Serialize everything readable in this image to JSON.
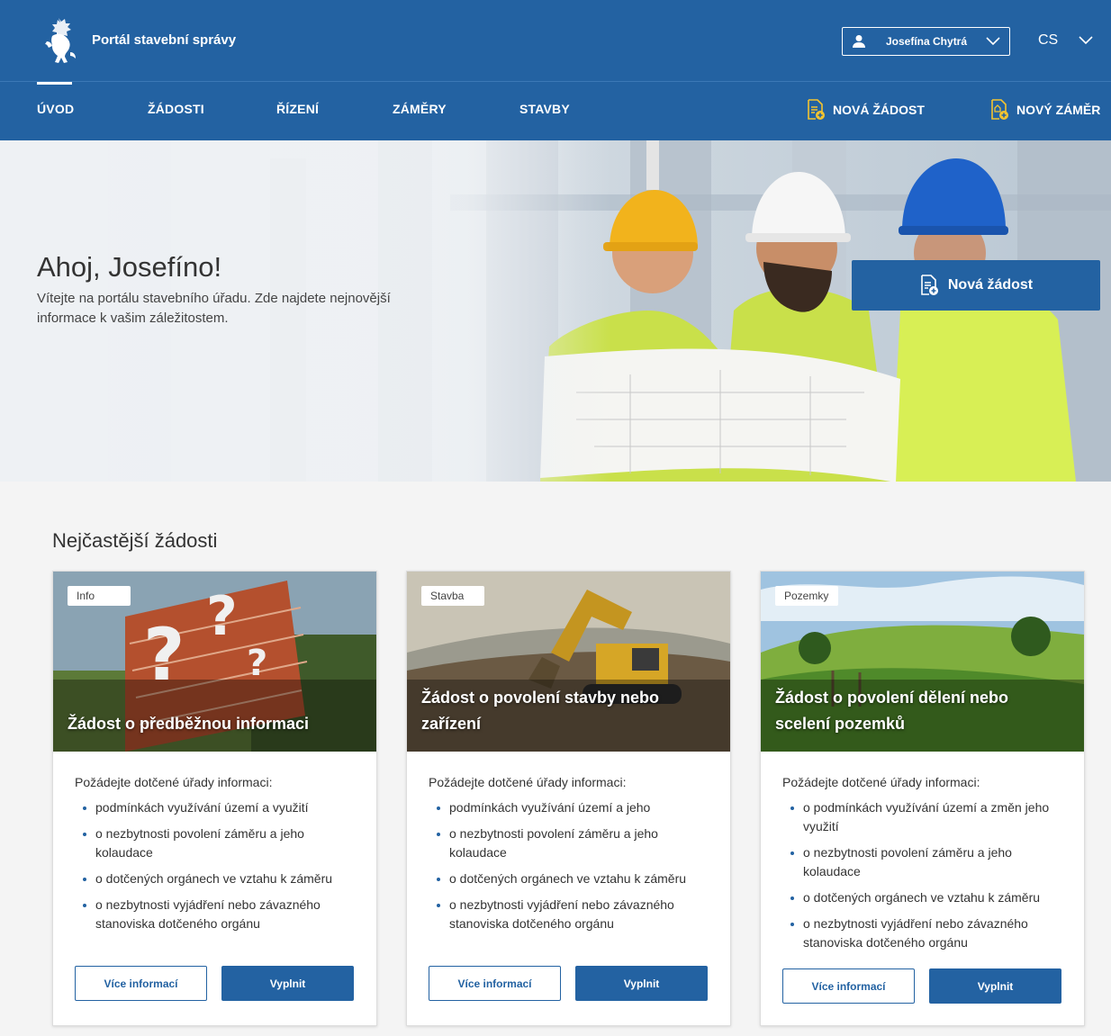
{
  "header": {
    "site_title": "Portál stavební správy",
    "user_name": "Josefína Chytrá",
    "language": "CS",
    "logo": "lion-emblem-icon"
  },
  "nav": {
    "items": [
      "ÚVOD",
      "ŽÁDOSTI",
      "ŘÍZENÍ",
      "ZÁMĚRY",
      "STAVBY"
    ],
    "active": "ÚVOD",
    "actions": [
      "NOVÁ ŽÁDOST",
      "NOVÝ ZÁMĚR"
    ]
  },
  "hero": {
    "title": "Ahoj, Josefíno!",
    "text": "Vítejte na portálu stavebního úřadu. Zde najdete nejnovější informace k vašim záležitostem.",
    "button": "Nová žádost"
  },
  "section": {
    "title": "Nejčastější žádosti"
  },
  "cards": [
    {
      "tag": "Info",
      "title": "Žádost o předběžnou informaci",
      "intro": "Požádejte dotčené úřady informaci:",
      "items": [
        "podmínkách využívání území a využití",
        "o nezbytnosti povolení záměru a jeho kolaudace",
        "o dotčených orgánech ve vztahu k záměru",
        "o nezbytnosti vyjádření nebo závazného stanoviska dotčeného orgánu"
      ],
      "more": "Více informací",
      "fill": "Vyplnit"
    },
    {
      "tag": "Stavba",
      "title": "Žádost o povolení stavby nebo zařízení",
      "intro": "Požádejte dotčené úřady informaci:",
      "items": [
        "podmínkách využívání území a jeho",
        "o nezbytnosti povolení záměru a jeho kolaudace",
        "o dotčených orgánech ve vztahu k záměru",
        "o nezbytnosti vyjádření nebo závazného stanoviska dotčeného orgánu"
      ],
      "more": "Více informací",
      "fill": "Vyplnit"
    },
    {
      "tag": "Pozemky",
      "title": "Žádost o povolení dělení nebo scelení pozemků",
      "intro": "Požádejte dotčené úřady informaci:",
      "items": [
        "o podmínkách využívání území a změn jeho využití",
        "o nezbytnosti povolení záměru a jeho kolaudace",
        "o dotčených orgánech ve vztahu k záměru",
        "o nezbytnosti vyjádření nebo závazného stanoviska dotčeného orgánu"
      ],
      "more": "Více informací",
      "fill": "Vyplnit"
    }
  ],
  "colors": {
    "primary": "#2362a2",
    "accent_icon": "#f4c430",
    "background": "#f4f4f4"
  }
}
